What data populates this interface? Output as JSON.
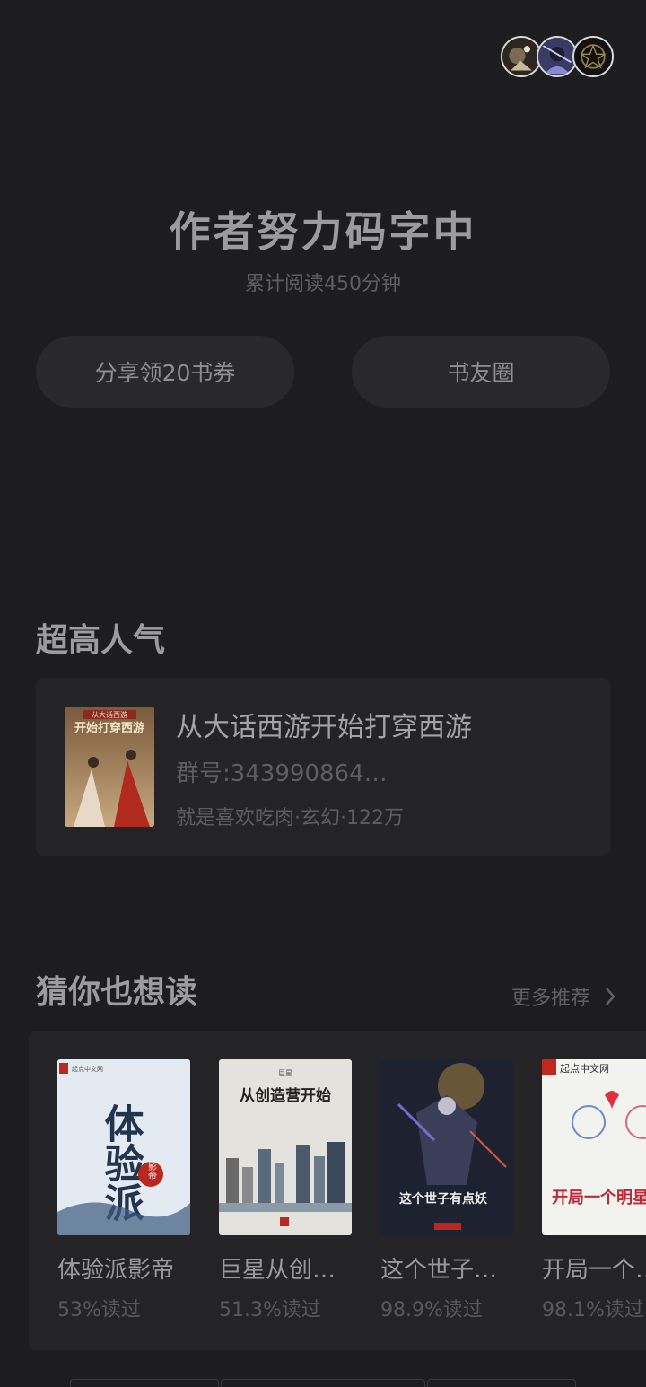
{
  "header": {
    "avatars": [
      {
        "icon": "reader-avatar-1"
      },
      {
        "icon": "reader-avatar-2"
      },
      {
        "icon": "reader-avatar-3"
      }
    ]
  },
  "hero": {
    "title": "作者努力码字中",
    "subtitle": "累计阅读450分钟",
    "share_button": "分享领20书券",
    "circle_button": "书友圈"
  },
  "popular": {
    "section_title": "超高人气",
    "book": {
      "title": "从大话西游开始打穿西游",
      "group": "群号:343990864…",
      "meta": "就是喜欢吃肉·玄幻·122万",
      "cover_text": "开始打穿西游",
      "cover_top_text": "从大话西游"
    }
  },
  "recommend": {
    "section_title": "猜你也想读",
    "more_label": "更多推荐",
    "books": [
      {
        "title": "体验派影帝",
        "read_pct": "53%读过",
        "cover_brand": "起点中文网",
        "cover_text": "体验派",
        "cover_accent": "影帝"
      },
      {
        "title": "巨星从创…",
        "read_pct": "51.3%读过",
        "cover_brand": "巨星",
        "cover_text": "从创造营开始"
      },
      {
        "title": "这个世子…",
        "read_pct": "98.9%读过",
        "cover_text": "这个世子有点妖"
      },
      {
        "title": "开局一个…",
        "read_pct": "98.1%读过",
        "cover_brand": "起点中文网",
        "cover_text": "开局一个明星老"
      }
    ]
  },
  "colors": {
    "background": "#1d1d1f",
    "card": "#242426",
    "pill": "#29292b",
    "text_primary": "#9b9b9d",
    "text_secondary": "#5f5f62"
  }
}
